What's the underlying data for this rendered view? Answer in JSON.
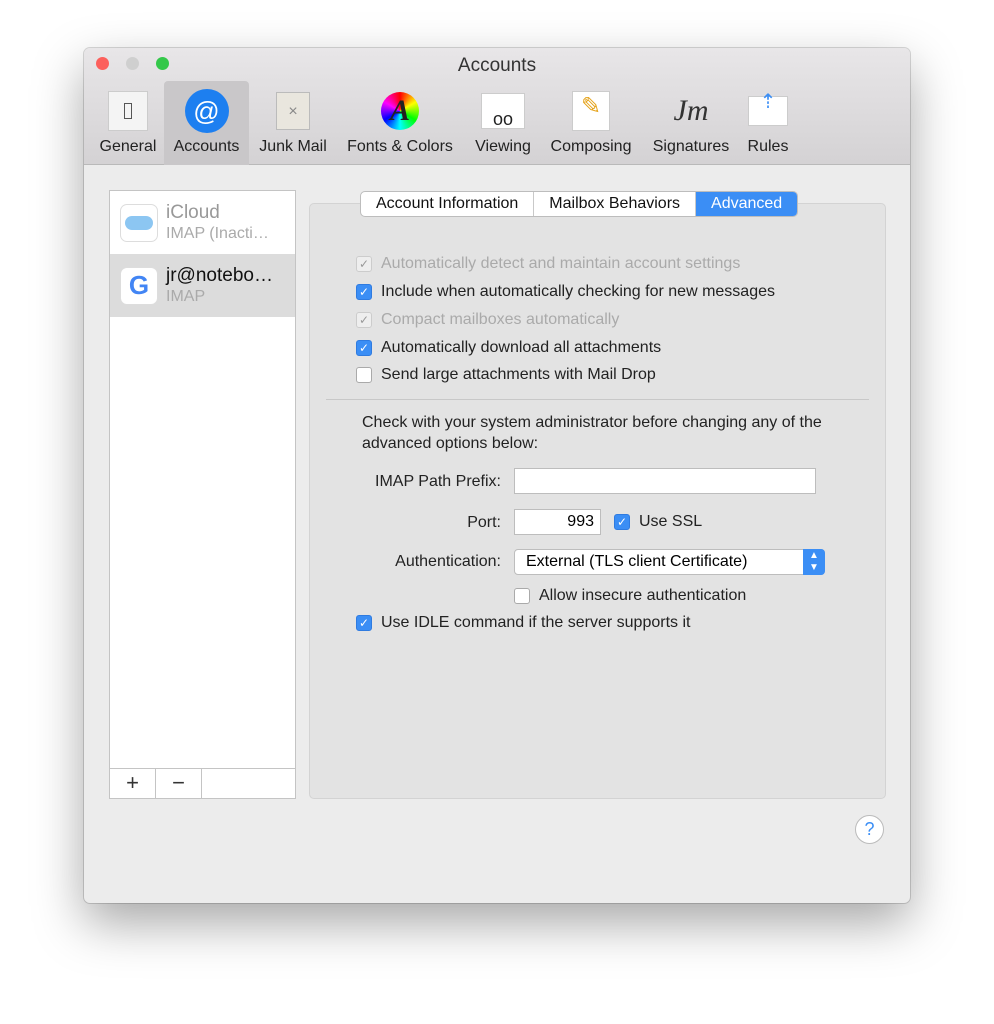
{
  "window": {
    "title": "Accounts"
  },
  "toolbar": [
    {
      "label": "General",
      "icon": "switch-icon"
    },
    {
      "label": "Accounts",
      "icon": "at-icon"
    },
    {
      "label": "Junk Mail",
      "icon": "trash-icon"
    },
    {
      "label": "Fonts & Colors",
      "icon": "font-icon"
    },
    {
      "label": "Viewing",
      "icon": "glasses-icon"
    },
    {
      "label": "Composing",
      "icon": "pencil-icon"
    },
    {
      "label": "Signatures",
      "icon": "signature-icon"
    },
    {
      "label": "Rules",
      "icon": "rules-icon"
    }
  ],
  "accounts": [
    {
      "name": "iCloud",
      "type": "IMAP (Inacti…"
    },
    {
      "name": "jr@notebo…",
      "type": "IMAP"
    }
  ],
  "list_buttons": {
    "add": "+",
    "remove": "−"
  },
  "tabs": [
    "Account Information",
    "Mailbox Behaviors",
    "Advanced"
  ],
  "options": [
    {
      "label": "Automatically detect and maintain account settings",
      "checked": true,
      "disabled": true
    },
    {
      "label": "Include when automatically checking for new messages",
      "checked": true,
      "disabled": false
    },
    {
      "label": "Compact mailboxes automatically",
      "checked": true,
      "disabled": true
    },
    {
      "label": "Automatically download all attachments",
      "checked": true,
      "disabled": false
    },
    {
      "label": "Send large attachments with Mail Drop",
      "checked": false,
      "disabled": false
    }
  ],
  "advanced": {
    "note": "Check with your system administrator before changing any of the advanced options below:",
    "prefix_label": "IMAP Path Prefix:",
    "prefix_value": "",
    "port_label": "Port:",
    "port_value": "993",
    "ssl_label": "Use SSL",
    "auth_label": "Authentication:",
    "auth_value": "External (TLS client Certificate)",
    "insecure_label": "Allow insecure authentication",
    "idle_label": "Use IDLE command if the server supports it"
  },
  "help": "?",
  "accent": "#3b8ef5"
}
